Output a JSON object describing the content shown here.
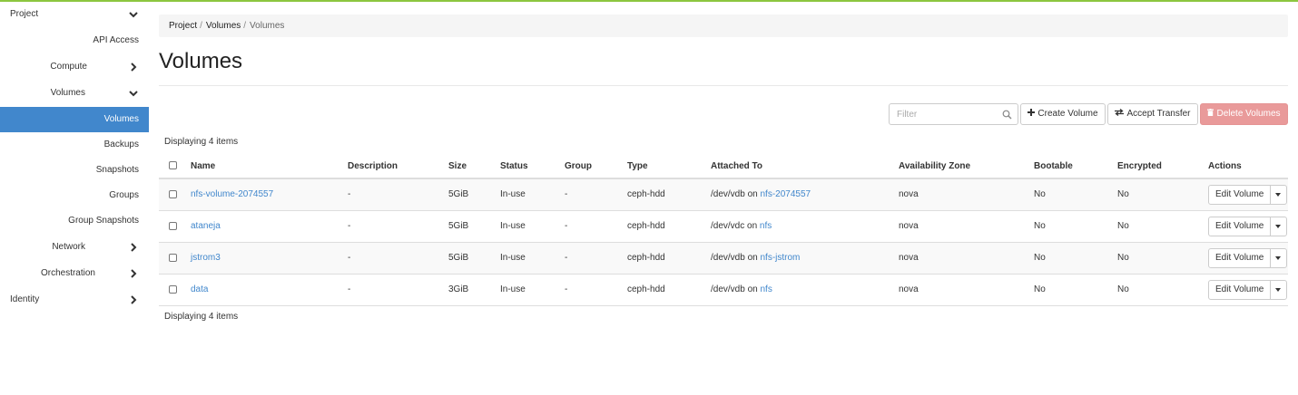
{
  "sidebar": {
    "items": [
      {
        "label": "Project",
        "chevron": "down"
      },
      {
        "label": "API Access"
      },
      {
        "label": "Compute",
        "chevron": "right"
      },
      {
        "label": "Volumes",
        "chevron": "down"
      },
      {
        "label": "Volumes",
        "active": true
      },
      {
        "label": "Backups"
      },
      {
        "label": "Snapshots"
      },
      {
        "label": "Groups"
      },
      {
        "label": "Group Snapshots"
      },
      {
        "label": "Network",
        "chevron": "right"
      },
      {
        "label": "Orchestration",
        "chevron": "right"
      },
      {
        "label": "Identity",
        "chevron": "right"
      }
    ]
  },
  "breadcrumb": [
    "Project",
    "Volumes",
    "Volumes"
  ],
  "page_title": "Volumes",
  "toolbar": {
    "filter_placeholder": "Filter",
    "create_label": "Create Volume",
    "accept_label": "Accept Transfer",
    "delete_label": "Delete Volumes"
  },
  "displaying_text": "Displaying 4 items",
  "table": {
    "columns": [
      "Name",
      "Description",
      "Size",
      "Status",
      "Group",
      "Type",
      "Attached To",
      "Availability Zone",
      "Bootable",
      "Encrypted",
      "Actions"
    ],
    "rows": [
      {
        "name": "nfs-volume-2074557",
        "description": "-",
        "size": "5GiB",
        "status": "In-use",
        "group": "-",
        "type": "ceph-hdd",
        "attached_prefix": "/dev/vdb on ",
        "attached_link": "nfs-2074557",
        "zone": "nova",
        "bootable": "No",
        "encrypted": "No",
        "action": "Edit Volume"
      },
      {
        "name": "ataneja",
        "description": "-",
        "size": "5GiB",
        "status": "In-use",
        "group": "-",
        "type": "ceph-hdd",
        "attached_prefix": "/dev/vdc on ",
        "attached_link": "nfs",
        "zone": "nova",
        "bootable": "No",
        "encrypted": "No",
        "action": "Edit Volume"
      },
      {
        "name": "jstrom3",
        "description": "-",
        "size": "5GiB",
        "status": "In-use",
        "group": "-",
        "type": "ceph-hdd",
        "attached_prefix": "/dev/vdb on ",
        "attached_link": "nfs-jstrom",
        "zone": "nova",
        "bootable": "No",
        "encrypted": "No",
        "action": "Edit Volume"
      },
      {
        "name": "data",
        "description": "-",
        "size": "3GiB",
        "status": "In-use",
        "group": "-",
        "type": "ceph-hdd",
        "attached_prefix": "/dev/vdb on ",
        "attached_link": "nfs",
        "zone": "nova",
        "bootable": "No",
        "encrypted": "No",
        "action": "Edit Volume"
      }
    ]
  },
  "colors": {
    "accent": "#4187cc",
    "danger": "#e99a9a",
    "topbar": "#8cc63f"
  },
  "icons": {
    "filter": "search-icon",
    "create": "plus-icon",
    "accept": "transfer-icon",
    "delete": "trash-icon"
  }
}
